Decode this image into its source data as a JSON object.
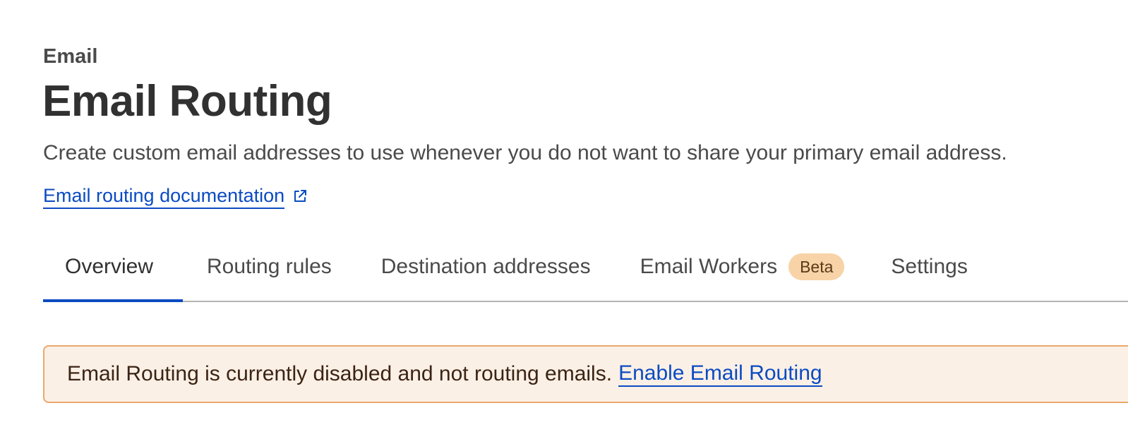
{
  "header": {
    "breadcrumb": "Email",
    "title": "Email Routing",
    "description": "Create custom email addresses to use whenever you do not want to share your primary email address.",
    "doc_link": "Email routing documentation",
    "doc_link_icon": "external-link-icon"
  },
  "tabs": [
    {
      "label": "Overview",
      "active": true
    },
    {
      "label": "Routing rules",
      "active": false
    },
    {
      "label": "Destination addresses",
      "active": false
    },
    {
      "label": "Email Workers",
      "active": false,
      "badge": "Beta"
    },
    {
      "label": "Settings",
      "active": false
    }
  ],
  "alert": {
    "message": "Email Routing is currently disabled and not routing emails.",
    "action_link": "Enable Email Routing"
  },
  "colors": {
    "link": "#0b4bc2",
    "alert_background": "#fbf0e6",
    "alert_border": "#e9a96b",
    "badge_background": "#f7d3a7"
  }
}
